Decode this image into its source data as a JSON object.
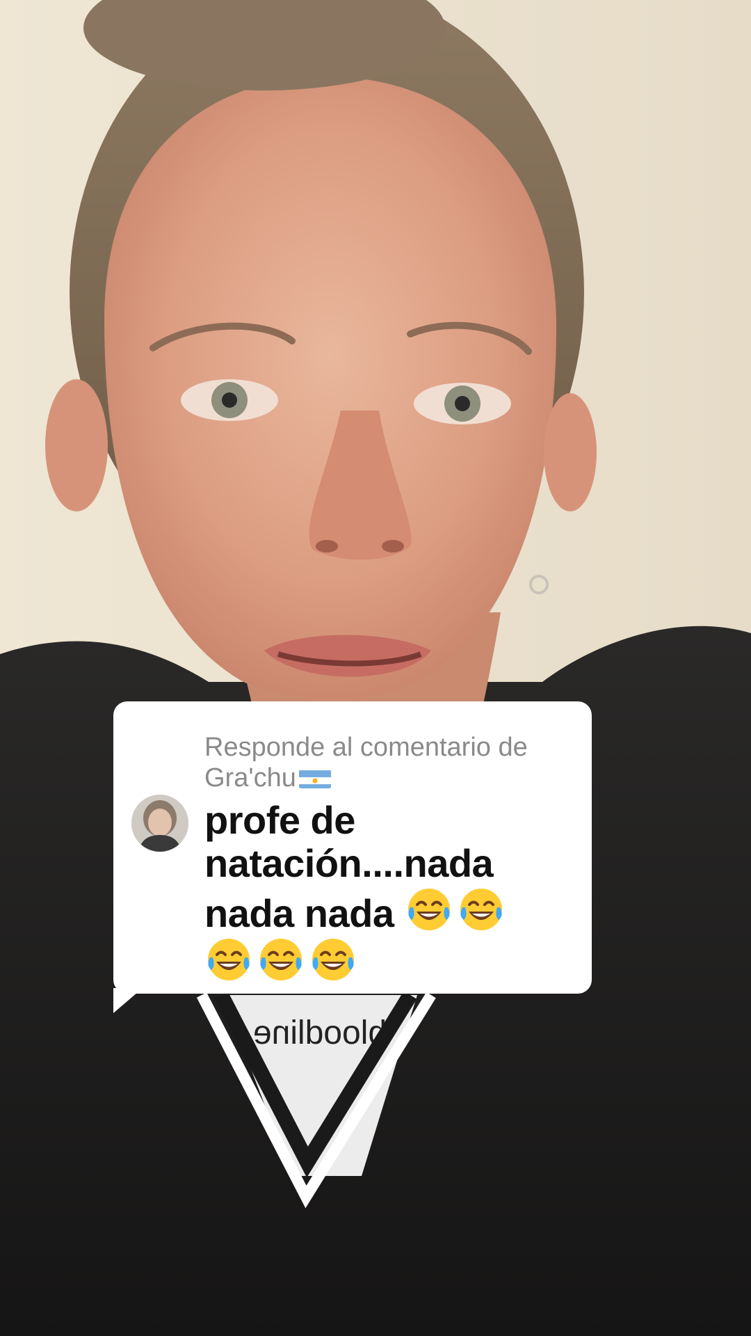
{
  "comment_sticker": {
    "header": "Responde al comentario de",
    "username": "Gra'chu",
    "username_flag_icon": "argentina-flag-icon",
    "avatar_icon": "user-avatar",
    "comment_text": "profe de natación....nada nada nada",
    "emoji_icon": "face-with-tears-of-joy-icon",
    "emoji_count": 5
  },
  "video": {
    "shirt_logo_text": "bloodline"
  },
  "colors": {
    "card_background": "#ffffff",
    "header_text": "#8a8a8a",
    "comment_text": "#111111",
    "flag_blue": "#74acdf",
    "flag_sun": "#f6b40e",
    "emoji_face": "#ffcc33",
    "emoji_tears": "#3fa9f5"
  }
}
